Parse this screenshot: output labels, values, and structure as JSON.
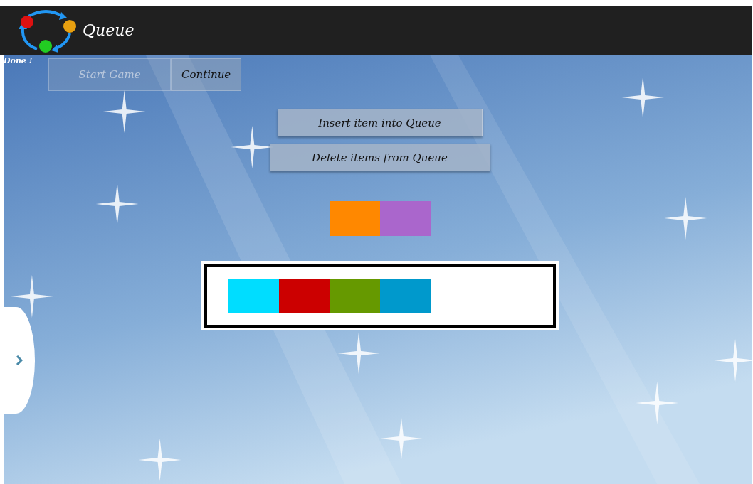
{
  "header": {
    "title": "Queue"
  },
  "status": "Done !",
  "game_buttons": [
    {
      "label": "Start Game",
      "disabled": true
    },
    {
      "label": "Continue",
      "disabled": false
    }
  ],
  "actions": [
    {
      "label": "Insert item into Queue"
    },
    {
      "label": "Delete items from Queue"
    }
  ],
  "removed_items": [
    {
      "color": "#ff8800"
    },
    {
      "color": "#aa66cc"
    }
  ],
  "queue_items": [
    {
      "color": "#00ddff"
    },
    {
      "color": "#cc0000"
    },
    {
      "color": "#669900"
    },
    {
      "color": "#0099cc"
    }
  ]
}
